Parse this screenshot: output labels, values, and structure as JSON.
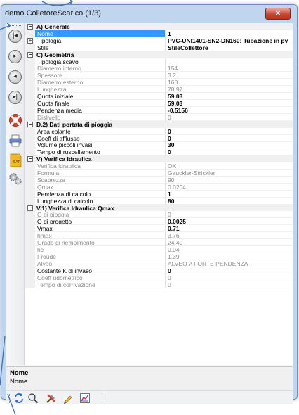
{
  "window": {
    "title": "demo.ColletoreScarico (1/3)",
    "close_label": "✕"
  },
  "left_toolbar": {
    "icons": [
      "first-record-icon",
      "next-record-icon",
      "previous-record-icon",
      "last-record-icon",
      "lifebuoy-icon",
      "printer-icon",
      "tag-icon",
      "gears-icon"
    ]
  },
  "grid": {
    "sections": [
      {
        "title": "A) Generale",
        "rows": [
          {
            "name": "Nome",
            "value": "1",
            "selected": true,
            "bold": true
          },
          {
            "name": "Tipologia",
            "value": "PVC-UNI1401-SN2-DN160: Tubazione in pv",
            "bold": true,
            "expandable": true
          },
          {
            "name": "Stile",
            "value": "StileCollettore",
            "bold": true
          }
        ]
      },
      {
        "title": "C) Geometria",
        "rows": [
          {
            "name": "Tipologia scavo",
            "value": ""
          },
          {
            "name": "Diametro interno",
            "value": "154",
            "readonly": true
          },
          {
            "name": "Spessore",
            "value": "3.2",
            "readonly": true
          },
          {
            "name": "Diametro esterno",
            "value": "160",
            "readonly": true
          },
          {
            "name": "Lunghezza",
            "value": "78.97",
            "readonly": true
          },
          {
            "name": "Quota iniziale",
            "value": "59.03",
            "bold": true
          },
          {
            "name": "Quota finale",
            "value": "59.03",
            "bold": true
          },
          {
            "name": "Pendenza media",
            "value": "-0.5156",
            "bold": true
          },
          {
            "name": "Dislivello",
            "value": "0",
            "readonly": true
          }
        ]
      },
      {
        "title": "D.2) Dati portata di pioggia",
        "rows": [
          {
            "name": "Area colante",
            "value": "0",
            "bold": true
          },
          {
            "name": "Coeff di afflusso",
            "value": "0",
            "bold": true
          },
          {
            "name": "Volume piccoli invasi",
            "value": "30",
            "bold": true
          },
          {
            "name": "Tempo di ruscellamento",
            "value": "0",
            "bold": true
          }
        ]
      },
      {
        "title": "V) Verifica Idraulica",
        "rows": [
          {
            "name": "Verifica idraulica",
            "value": "OK",
            "readonly": true
          },
          {
            "name": "Formula",
            "value": "Gauckler-Strickler",
            "readonly": true
          },
          {
            "name": "Scabrezza",
            "value": "90",
            "readonly": true
          },
          {
            "name": "Qmax",
            "value": "0.0204",
            "readonly": true
          },
          {
            "name": "Pendenza di calcolo",
            "value": "1",
            "bold": true
          },
          {
            "name": "Lunghezza di calcolo",
            "value": "80",
            "bold": true
          }
        ]
      },
      {
        "title": "V.1) Verifica Idraulica Qmax",
        "rows": [
          {
            "name": "Q di pioggia",
            "value": "0",
            "readonly": true
          },
          {
            "name": "Q di progetto",
            "value": "0.0025",
            "bold": true
          },
          {
            "name": "Vmax",
            "value": "0.71",
            "bold": true
          },
          {
            "name": "hmax",
            "value": "3.76",
            "readonly": true
          },
          {
            "name": "Grado di riempimento",
            "value": "24.49",
            "readonly": true
          },
          {
            "name": "hc",
            "value": "0.04",
            "readonly": true
          },
          {
            "name": "Froude",
            "value": "1.39",
            "readonly": true
          },
          {
            "name": "Alveo",
            "value": "ALVEO A FORTE PENDENZA",
            "readonly": true
          },
          {
            "name": "Costante K di invaso",
            "value": "0",
            "bold": true
          },
          {
            "name": "Coeff udometrico",
            "value": "0",
            "readonly": true
          },
          {
            "name": "Tempo di corrivazione",
            "value": "0",
            "readonly": true
          }
        ]
      }
    ]
  },
  "description": {
    "title": "Nome",
    "text": "Nome"
  },
  "bottom_toolbar": {
    "icons": [
      "refresh-icon",
      "zoom-icon",
      "tools-icon",
      "pencil-icon",
      "chart-icon"
    ]
  },
  "colors": {
    "selection": "#3399ff",
    "frame": "#bfd6ee",
    "readonly_text": "#8c8c8c",
    "annotation_line": "#3f6fb5"
  }
}
